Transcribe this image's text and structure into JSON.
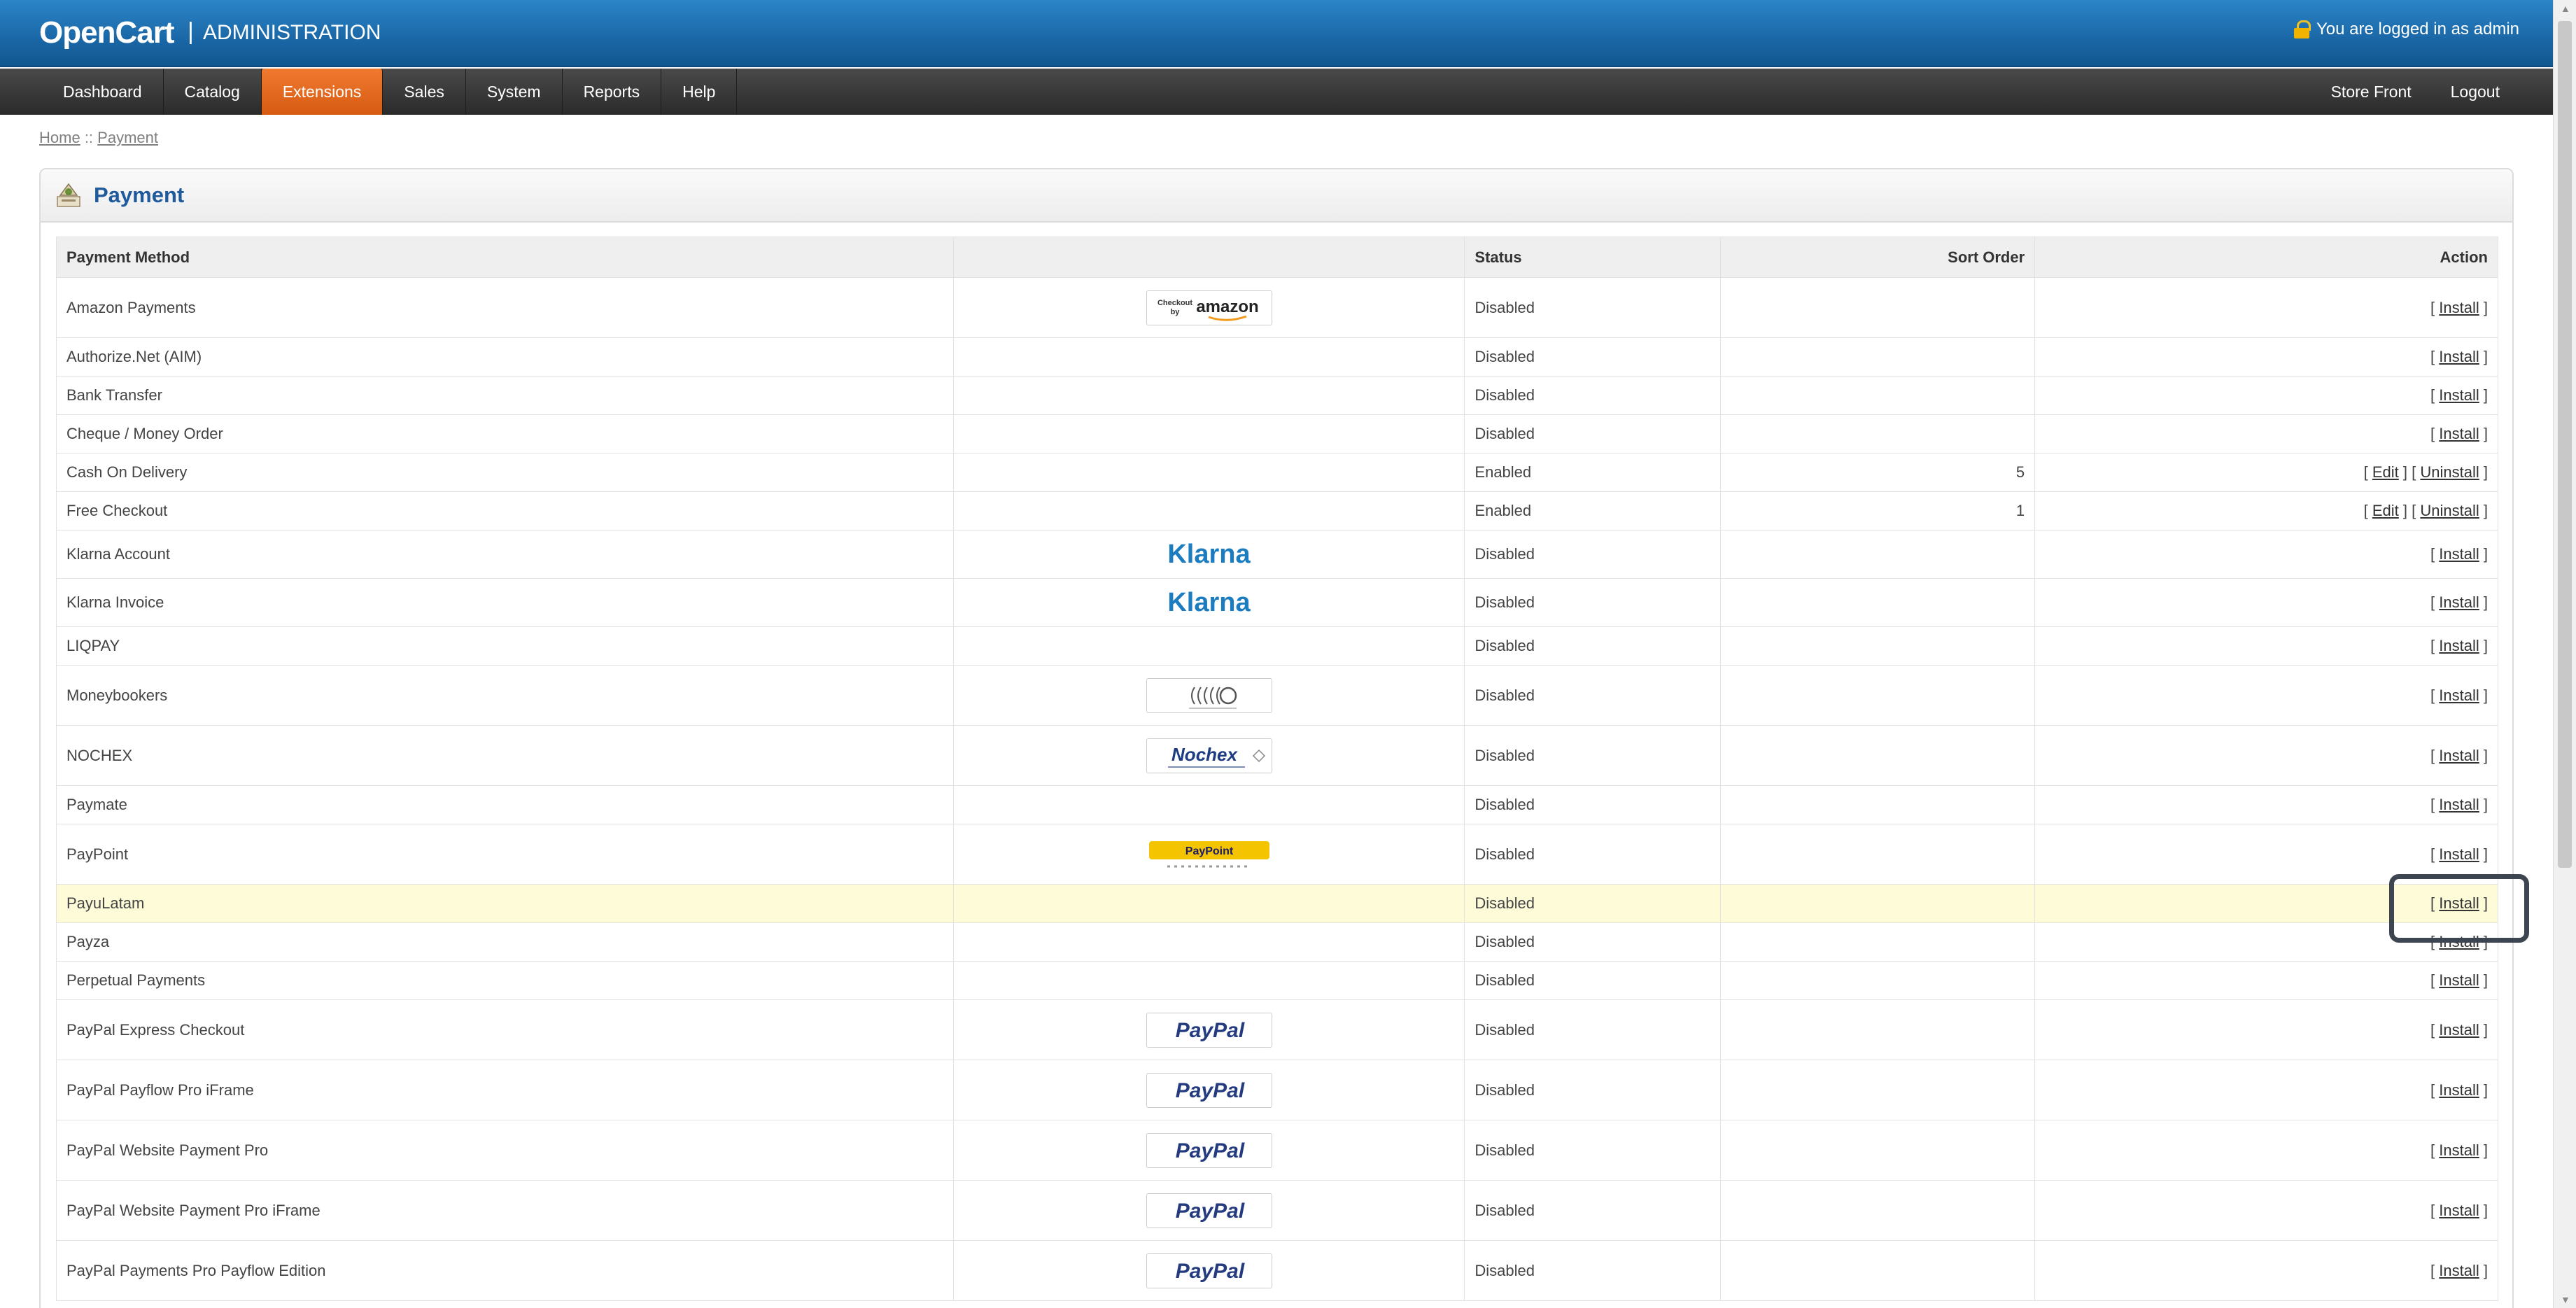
{
  "header": {
    "logo": "OpenCart",
    "separator": "|",
    "subtitle": "ADMINISTRATION",
    "login_text": "You are logged in as admin"
  },
  "menu": {
    "items": [
      "Dashboard",
      "Catalog",
      "Extensions",
      "Sales",
      "System",
      "Reports",
      "Help"
    ],
    "active": "Extensions",
    "right_items": [
      "Store Front",
      "Logout"
    ]
  },
  "breadcrumb": {
    "home": "Home",
    "sep": "::",
    "current": "Payment"
  },
  "panel": {
    "title": "Payment"
  },
  "table": {
    "headers": {
      "method": "Payment Method",
      "logo": "",
      "status": "Status",
      "sort": "Sort Order",
      "action": "Action"
    },
    "rows": [
      {
        "name": "Amazon Payments",
        "logo": "amazon-checkout",
        "status": "Disabled",
        "sort": "",
        "actions": [
          "Install"
        ]
      },
      {
        "name": "Authorize.Net (AIM)",
        "logo": "",
        "status": "Disabled",
        "sort": "",
        "actions": [
          "Install"
        ]
      },
      {
        "name": "Bank Transfer",
        "logo": "",
        "status": "Disabled",
        "sort": "",
        "actions": [
          "Install"
        ]
      },
      {
        "name": "Cheque / Money Order",
        "logo": "",
        "status": "Disabled",
        "sort": "",
        "actions": [
          "Install"
        ]
      },
      {
        "name": "Cash On Delivery",
        "logo": "",
        "status": "Enabled",
        "sort": "5",
        "actions": [
          "Edit",
          "Uninstall"
        ]
      },
      {
        "name": "Free Checkout",
        "logo": "",
        "status": "Enabled",
        "sort": "1",
        "actions": [
          "Edit",
          "Uninstall"
        ]
      },
      {
        "name": "Klarna Account",
        "logo": "klarna",
        "status": "Disabled",
        "sort": "",
        "actions": [
          "Install"
        ]
      },
      {
        "name": "Klarna Invoice",
        "logo": "klarna",
        "status": "Disabled",
        "sort": "",
        "actions": [
          "Install"
        ]
      },
      {
        "name": "LIQPAY",
        "logo": "",
        "status": "Disabled",
        "sort": "",
        "actions": [
          "Install"
        ]
      },
      {
        "name": "Moneybookers",
        "logo": "moneybookers",
        "status": "Disabled",
        "sort": "",
        "actions": [
          "Install"
        ]
      },
      {
        "name": "NOCHEX",
        "logo": "nochex",
        "status": "Disabled",
        "sort": "",
        "actions": [
          "Install"
        ]
      },
      {
        "name": "Paymate",
        "logo": "",
        "status": "Disabled",
        "sort": "",
        "actions": [
          "Install"
        ]
      },
      {
        "name": "PayPoint",
        "logo": "paypoint",
        "status": "Disabled",
        "sort": "",
        "actions": [
          "Install"
        ]
      },
      {
        "name": "PayuLatam",
        "logo": "",
        "status": "Disabled",
        "sort": "",
        "actions": [
          "Install"
        ],
        "highlighted": true
      },
      {
        "name": "Payza",
        "logo": "",
        "status": "Disabled",
        "sort": "",
        "actions": [
          "Install"
        ]
      },
      {
        "name": "Perpetual Payments",
        "logo": "",
        "status": "Disabled",
        "sort": "",
        "actions": [
          "Install"
        ]
      },
      {
        "name": "PayPal Express Checkout",
        "logo": "paypal",
        "status": "Disabled",
        "sort": "",
        "actions": [
          "Install"
        ]
      },
      {
        "name": "PayPal Payflow Pro iFrame",
        "logo": "paypal",
        "status": "Disabled",
        "sort": "",
        "actions": [
          "Install"
        ]
      },
      {
        "name": "PayPal Website Payment Pro",
        "logo": "paypal",
        "status": "Disabled",
        "sort": "",
        "actions": [
          "Install"
        ]
      },
      {
        "name": "PayPal Website Payment Pro iFrame",
        "logo": "paypal",
        "status": "Disabled",
        "sort": "",
        "actions": [
          "Install"
        ]
      },
      {
        "name": "PayPal Payments Pro Payflow Edition",
        "logo": "paypal",
        "status": "Disabled",
        "sort": "",
        "actions": [
          "Install"
        ]
      }
    ]
  },
  "logo_texts": {
    "amazon_top": "Checkout",
    "amazon_by": "by",
    "amazon": "amazon",
    "klarna": "Klarna",
    "nochex": "Nochex",
    "paypoint": "PayPoint",
    "paypal": "PayPal"
  },
  "colors": {
    "header_blue": "#1a67a6",
    "menu_active": "#e0661e",
    "highlight_row": "#fefbd8",
    "title_blue": "#1f5a9c"
  }
}
